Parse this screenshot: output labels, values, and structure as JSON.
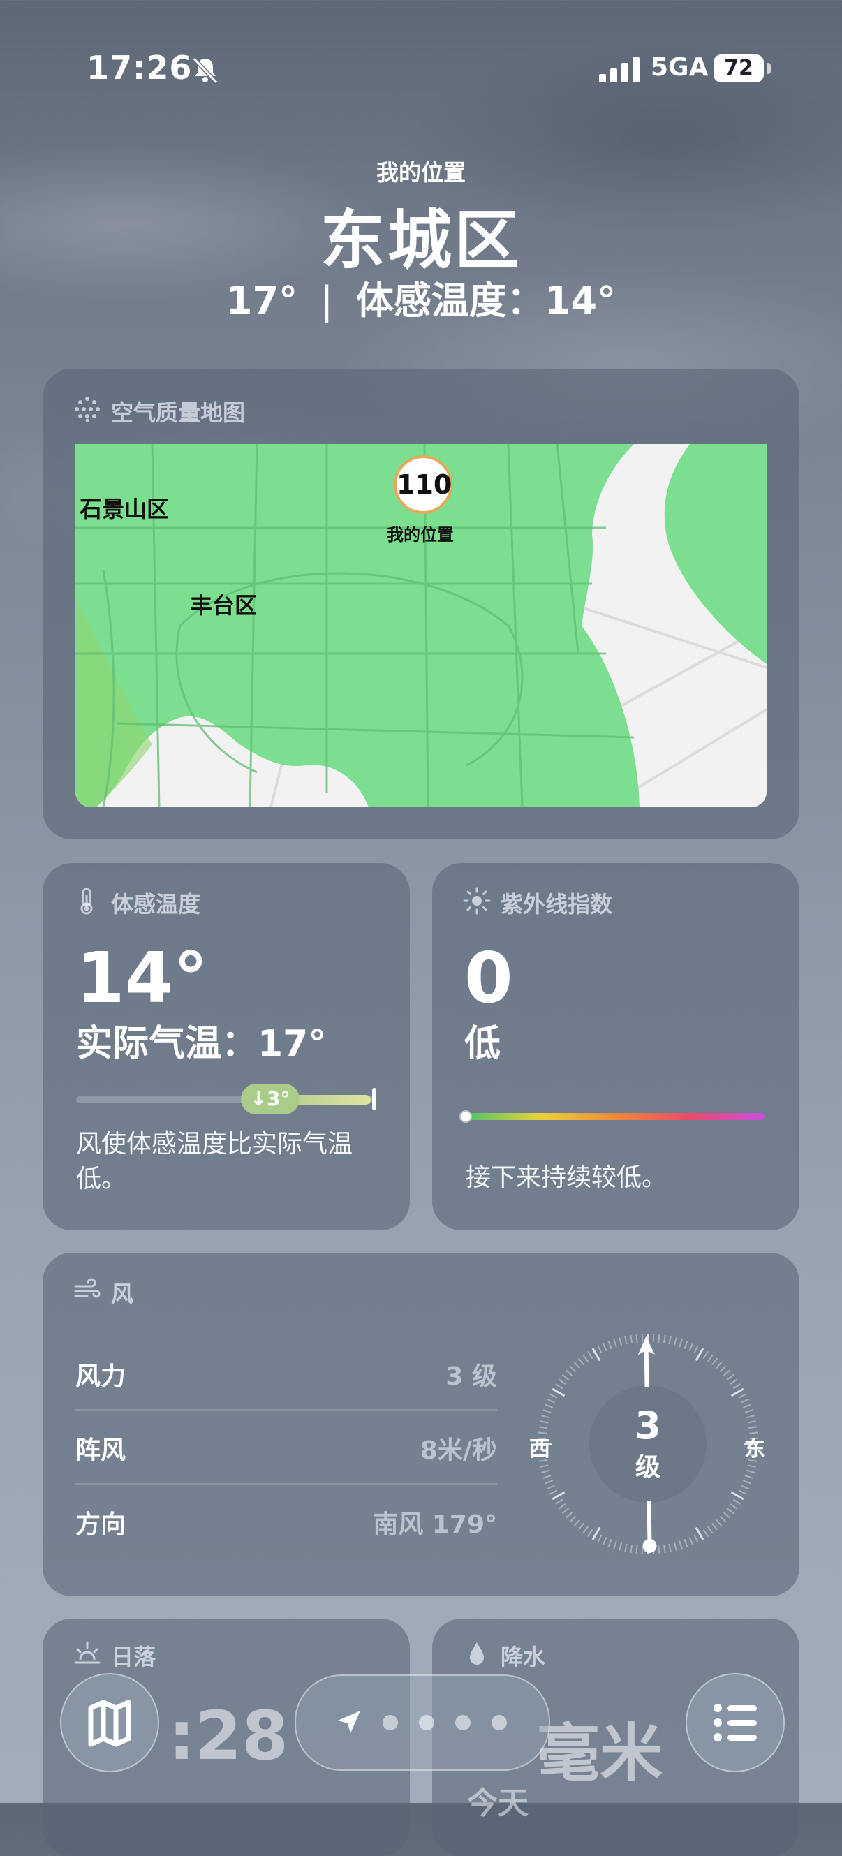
{
  "status": {
    "time": "17:26",
    "network": "5GA",
    "battery": "72"
  },
  "header": {
    "location_label": "我的位置",
    "city": "东城区",
    "temperature": "17°",
    "separator": "|",
    "feels_like": "体感温度：14°"
  },
  "air_quality_map": {
    "title": "空气质量地图",
    "aqi_value": "110",
    "my_location_label": "我的位置",
    "districts": [
      "石景山区",
      "丰台区"
    ]
  },
  "feels_like_card": {
    "title": "体感温度",
    "value": "14°",
    "actual": "实际气温：17°",
    "difference": "↓3°",
    "description": "风使体感温度比实际气温低。"
  },
  "uv_card": {
    "title": "紫外线指数",
    "value": "0",
    "level": "低",
    "index_fraction": 0.0,
    "description": "接下来持续较低。"
  },
  "wind_card": {
    "title": "风",
    "rows": [
      {
        "label": "风力",
        "value": "3 级"
      },
      {
        "label": "阵风",
        "value": "8米/秒"
      },
      {
        "label": "方向",
        "value": "南风 179°"
      }
    ],
    "compass": {
      "value": "3",
      "unit": "级",
      "west": "西",
      "east": "东",
      "direction_degrees": 179
    }
  },
  "sunset_card": {
    "title": "日落",
    "time_partial": ":28"
  },
  "precip_card": {
    "title": "降水",
    "value_partial": "毫米",
    "period_partial": "今天"
  },
  "toolbar": {
    "icons": [
      "map-icon",
      "location-arrow-icon",
      "list-icon"
    ]
  },
  "colors": {
    "aqi_green": "#7cdf8f",
    "aqi_badge_border": "#e6a85a",
    "uv_gradient": [
      "#4fc36b",
      "#e9d23a",
      "#f08a3a",
      "#e84b6a",
      "#c94fe0"
    ]
  }
}
